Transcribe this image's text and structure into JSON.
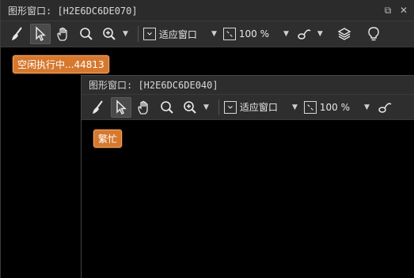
{
  "window1": {
    "title": "图形窗口:  [H2E6DC6DE070]",
    "status_badge": "空闲执行中...44813",
    "fit_label": "适应窗口",
    "zoom_label": "100 %"
  },
  "window2": {
    "title": "图形窗口:  [H2E6DC6DE040]",
    "status_badge": "繁忙",
    "fit_label": "适应窗口",
    "zoom_label": "100 %"
  },
  "window_controls": {
    "restore_symbol": "⧉",
    "close_symbol": "✕"
  },
  "toolbar_icons": [
    "broom-icon",
    "pointer-icon",
    "hand-icon",
    "search-icon",
    "zoom-in-icon",
    "fit-window-icon",
    "zoom-frame-icon",
    "shape-icon",
    "layers-icon",
    "lightbulb-icon"
  ],
  "colors": {
    "badge_bg": "#d6792f",
    "canvas_bg": "#000000",
    "toolbar_bg": "#2e2e2e"
  }
}
